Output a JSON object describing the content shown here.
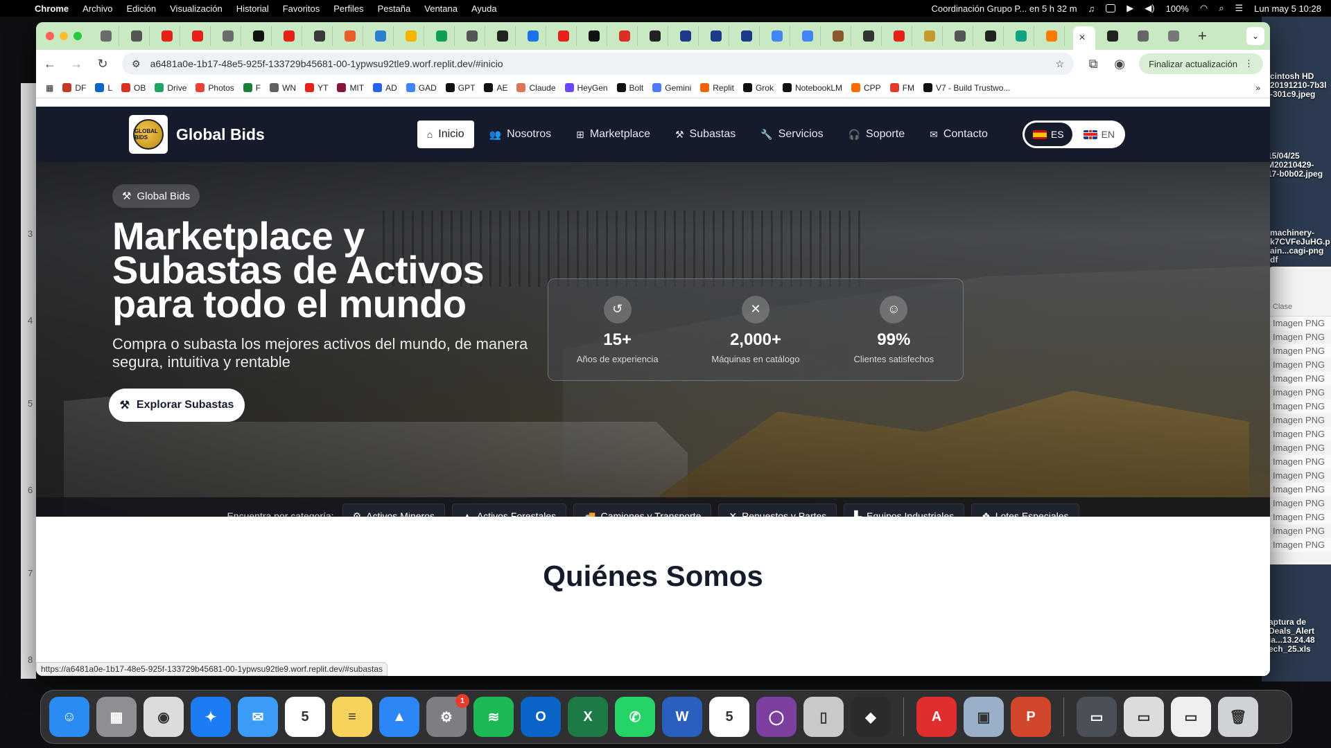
{
  "menubar": {
    "app": "Chrome",
    "items": [
      "Archivo",
      "Edición",
      "Visualización",
      "Historial",
      "Favoritos",
      "Perfiles",
      "Pestaña",
      "Ventana",
      "Ayuda"
    ],
    "reminder": "Coordinación Grupo P... en 5 h 32 m",
    "battery": "100%",
    "clock": "Lun may 5  10:28"
  },
  "desktop": {
    "labels": [
      "cintosh HD",
      "20191210-7b3l",
      "-301c9.jpeg",
      "15/04/25",
      "M20210429-",
      "17-b0b02.jpeg",
      "machinery-",
      "k7CVFeJuHG.p",
      "ain...cagi-png",
      "df",
      "aptura de",
      "Deals_Alert",
      "ia...13.24.48",
      "ech_25.xls"
    ],
    "finder_header": "Clase",
    "finder_rows": [
      "Imagen PNG",
      "Imagen PNG",
      "Imagen PNG",
      "Imagen PNG",
      "Imagen PNG",
      "Imagen PNG",
      "Imagen PNG",
      "Imagen PNG",
      "Imagen PNG",
      "Imagen PNG",
      "Imagen PNG",
      "Imagen PNG",
      "Imagen PNG",
      "Imagen PNG",
      "Imagen PNG",
      "Imagen PNG",
      "Imagen PNG"
    ]
  },
  "browser": {
    "url": "a6481a0e-1b17-48e5-925f-133729b45681-00-1ypwsu92tle9.worf.replit.dev/#inicio",
    "update_label": "Finalizar actualización",
    "tab_colors": [
      "#6b6b6b",
      "#555555",
      "#e62117",
      "#e62117",
      "#6b6b6b",
      "#111111",
      "#e62117",
      "#3a3a3a",
      "#e85d2a",
      "#2d7dd2",
      "#f4b400",
      "#0f9d58",
      "#555555",
      "#222222",
      "#1a73e8",
      "#e62117",
      "#111111",
      "#d93025",
      "#222222",
      "#1b3a8a",
      "#1b3a8a",
      "#1b3a8a",
      "#4285f4",
      "#4285f4",
      "#8a5a2b",
      "#333333",
      "#e62117",
      "#c49a2c",
      "#555555",
      "#222222",
      "#10a37f",
      "#f57c00"
    ],
    "active_tab_close": "×",
    "bookmarks": [
      {
        "label": "DF",
        "color": "#c0392b"
      },
      {
        "label": "L",
        "color": "#0a66c2"
      },
      {
        "label": "OB",
        "color": "#d93025"
      },
      {
        "label": "Drive",
        "color": "#1fa463"
      },
      {
        "label": "Photos",
        "color": "#ea4335"
      },
      {
        "label": "F",
        "color": "#188038"
      },
      {
        "label": "WN",
        "color": "#5f6368"
      },
      {
        "label": "YT",
        "color": "#e62117"
      },
      {
        "label": "MIT",
        "color": "#8a1538"
      },
      {
        "label": "AD",
        "color": "#2563eb"
      },
      {
        "label": "GAD",
        "color": "#4285f4"
      },
      {
        "label": "GPT",
        "color": "#111111"
      },
      {
        "label": "AE",
        "color": "#111111"
      },
      {
        "label": "Claude",
        "color": "#d97757"
      },
      {
        "label": "HeyGen",
        "color": "#6b46ff"
      },
      {
        "label": "Bolt",
        "color": "#111111"
      },
      {
        "label": "Gemini",
        "color": "#4e7cf6"
      },
      {
        "label": "Replit",
        "color": "#f26207"
      },
      {
        "label": "Grok",
        "color": "#111111"
      },
      {
        "label": "NotebookLM",
        "color": "#111111"
      },
      {
        "label": "CPP",
        "color": "#ff6a00"
      },
      {
        "label": "FM",
        "color": "#e23b2e"
      },
      {
        "label": "V7 - Build Trustwo...",
        "color": "#111111"
      }
    ],
    "status_url": "https://a6481a0e-1b17-48e5-925f-133729b45681-00-1ypwsu92tle9.worf.replit.dev/#subastas"
  },
  "site": {
    "brand": "Global Bids",
    "logo_text": "GLOBAL BIDS",
    "nav": [
      {
        "label": "Inicio",
        "icon": "home-icon",
        "active": true
      },
      {
        "label": "Nosotros",
        "icon": "users-icon",
        "active": false
      },
      {
        "label": "Marketplace",
        "icon": "grid-icon",
        "active": false
      },
      {
        "label": "Subastas",
        "icon": "gavel-icon",
        "active": false
      },
      {
        "label": "Servicios",
        "icon": "wrench-icon",
        "active": false
      },
      {
        "label": "Soporte",
        "icon": "headset-icon",
        "active": false
      },
      {
        "label": "Contacto",
        "icon": "envelope-icon",
        "active": false
      }
    ],
    "lang_es": "ES",
    "lang_en": "EN",
    "hero": {
      "badge": "Global Bids",
      "title": "Marketplace y Subastas de Activos para todo el mundo",
      "subtitle": "Compra o subasta los mejores activos del mundo, de manera segura, intuitiva y rentable",
      "cta": "Explorar Subastas"
    },
    "stats": [
      {
        "value": "15+",
        "label": "Años de experiencia",
        "icon": "history-icon"
      },
      {
        "value": "2,000+",
        "label": "Máquinas en catálogo",
        "icon": "tools-icon"
      },
      {
        "value": "99%",
        "label": "Clientes satisfechos",
        "icon": "smile-icon"
      }
    ],
    "categories_label": "Encuentra por categoría:",
    "categories": [
      {
        "label": "Activos Mineros",
        "icon": "mining-icon"
      },
      {
        "label": "Activos Forestales",
        "icon": "tree-icon"
      },
      {
        "label": "Camiones y Transporte",
        "icon": "truck-icon"
      },
      {
        "label": "Repuestos y Partes",
        "icon": "parts-icon"
      },
      {
        "label": "Equipos Industriales",
        "icon": "industry-icon"
      },
      {
        "label": "Lotes Especiales",
        "icon": "boxes-icon"
      }
    ],
    "next_section_title": "Quiénes Somos"
  },
  "dock": {
    "apps": [
      {
        "name": "finder",
        "color": "#2a8cf0",
        "glyph": "☺"
      },
      {
        "name": "launchpad",
        "color": "#8e8e93",
        "glyph": "▦"
      },
      {
        "name": "chrome",
        "color": "#dcdcdc",
        "glyph": "◉"
      },
      {
        "name": "safari",
        "color": "#1c7cf4",
        "glyph": "✦"
      },
      {
        "name": "mail",
        "color": "#3b9bf7",
        "glyph": "✉"
      },
      {
        "name": "calendar",
        "color": "#ffffff",
        "glyph": "5"
      },
      {
        "name": "notes",
        "color": "#f7d25c",
        "glyph": "≡"
      },
      {
        "name": "keynote",
        "color": "#2d86f5",
        "glyph": "▲"
      },
      {
        "name": "system-settings",
        "color": "#7d7d82",
        "glyph": "⚙",
        "badge": "1"
      },
      {
        "name": "spotify",
        "color": "#1db954",
        "glyph": "≋"
      },
      {
        "name": "outlook",
        "color": "#0a64c8",
        "glyph": "O"
      },
      {
        "name": "excel",
        "color": "#1d7a45",
        "glyph": "X"
      },
      {
        "name": "whatsapp",
        "color": "#25d366",
        "glyph": "✆"
      },
      {
        "name": "word",
        "color": "#2b5fbf",
        "glyph": "W"
      },
      {
        "name": "numbers",
        "color": "#ffffff",
        "glyph": "5"
      },
      {
        "name": "screen-recorder",
        "color": "#7b3fa0",
        "glyph": "◯"
      },
      {
        "name": "phone-mirror",
        "color": "#c9c9c9",
        "glyph": "▯"
      },
      {
        "name": "tool-app",
        "color": "#2b2b2b",
        "glyph": "◆"
      },
      {
        "name": "acrobat",
        "color": "#e02d2d",
        "glyph": "A"
      },
      {
        "name": "preview",
        "color": "#9ab0c8",
        "glyph": "▣"
      },
      {
        "name": "powerpoint",
        "color": "#d2472b",
        "glyph": "P"
      },
      {
        "name": "recent-doc",
        "color": "#4a4f58",
        "glyph": "▭"
      },
      {
        "name": "recent-doc-2",
        "color": "#dcdcdc",
        "glyph": "▭"
      },
      {
        "name": "recent-doc-3",
        "color": "#efefef",
        "glyph": "▭"
      },
      {
        "name": "trash",
        "color": "#cfd3d8",
        "glyph": "🗑"
      }
    ]
  }
}
